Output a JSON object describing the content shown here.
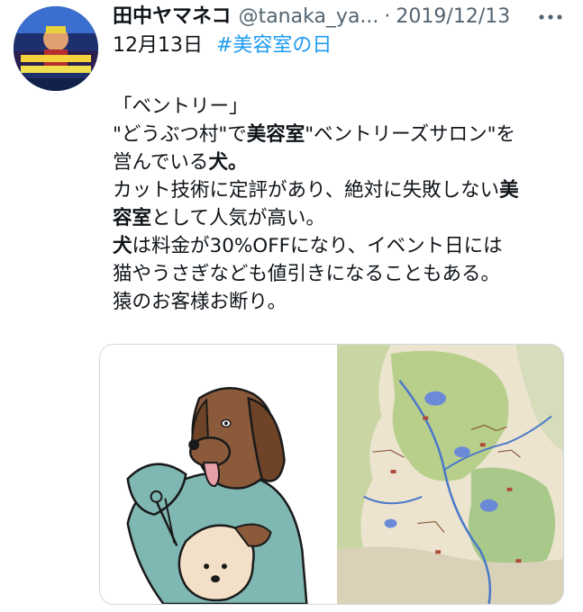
{
  "tweet": {
    "author_name": "田中ヤマネコ",
    "handle": "@tanaka_ya...",
    "separator": "·",
    "date": "2019/12/13",
    "date_line": "12月13日",
    "hashtag": "#美容室の日",
    "body": {
      "line1": "「ベントリー」",
      "line2_a": "\"どうぶつ村\"で",
      "line2_b": "美容室",
      "line2_c": "\"ベントリーズサロン\"を",
      "line3_a": "営んでいる",
      "line3_b": "犬。",
      "line4_a": "カット技術に定評があり、絶対に失敗しない",
      "line4_b": "美",
      "line5_a": "容室",
      "line5_b": "として人気が高い。",
      "line6_a": "犬",
      "line6_b": "は料金が30%OFFになり、イベント日には",
      "line7": "猫やうさぎなども値引きになることもある。",
      "line8": "猿のお客様お断り。"
    }
  },
  "icons": {
    "more": "more-horizontal-icon"
  },
  "colors": {
    "link": "#1d9bf0",
    "secondary_text": "#536471",
    "primary_text": "#0f1419"
  }
}
